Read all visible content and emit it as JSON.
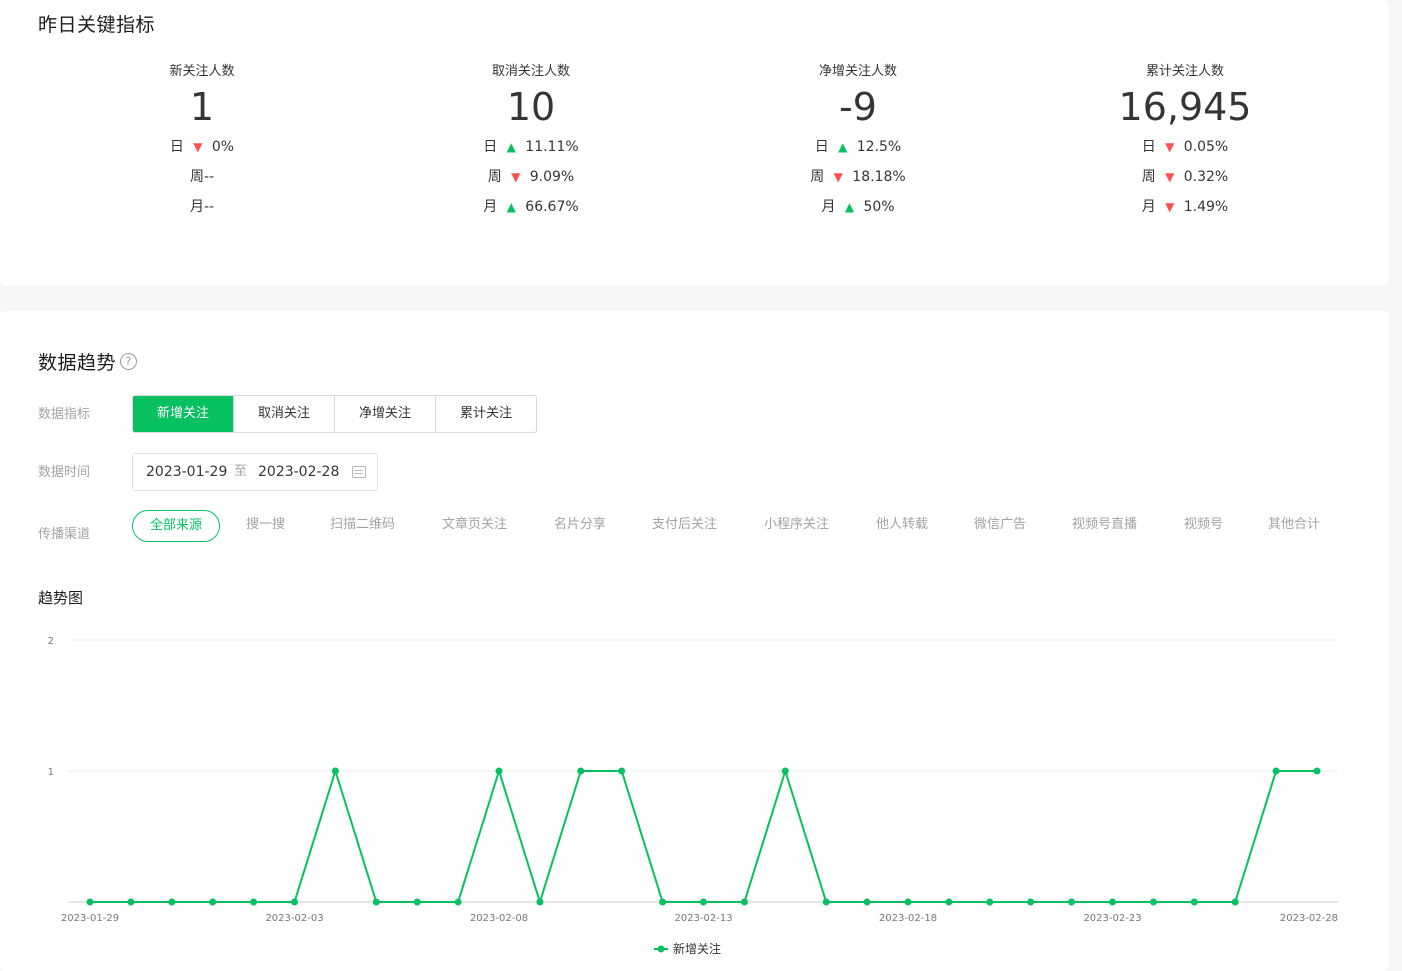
{
  "yesterday": {
    "title": "昨日关键指标",
    "metrics": [
      {
        "label": "新关注人数",
        "value": "1",
        "rows": [
          {
            "period": "日",
            "direction": "down",
            "change": "0%"
          },
          {
            "period": "周",
            "direction": "none",
            "change": "--"
          },
          {
            "period": "月",
            "direction": "none",
            "change": "--"
          }
        ]
      },
      {
        "label": "取消关注人数",
        "value": "10",
        "rows": [
          {
            "period": "日",
            "direction": "up",
            "change": "11.11%"
          },
          {
            "period": "周",
            "direction": "down",
            "change": "9.09%"
          },
          {
            "period": "月",
            "direction": "up",
            "change": "66.67%"
          }
        ]
      },
      {
        "label": "净增关注人数",
        "value": "-9",
        "rows": [
          {
            "period": "日",
            "direction": "up",
            "change": "12.5%"
          },
          {
            "period": "周",
            "direction": "down",
            "change": "18.18%"
          },
          {
            "period": "月",
            "direction": "up",
            "change": "50%"
          }
        ]
      },
      {
        "label": "累计关注人数",
        "value": "16,945",
        "rows": [
          {
            "period": "日",
            "direction": "down",
            "change": "0.05%"
          },
          {
            "period": "周",
            "direction": "down",
            "change": "0.32%"
          },
          {
            "period": "月",
            "direction": "down",
            "change": "1.49%"
          }
        ]
      }
    ]
  },
  "trend": {
    "title": "数据趋势",
    "help_glyph": "?",
    "metric_label": "数据指标",
    "metric_tabs": [
      {
        "label": "新增关注",
        "active": true
      },
      {
        "label": "取消关注",
        "active": false
      },
      {
        "label": "净增关注",
        "active": false
      },
      {
        "label": "累计关注",
        "active": false
      }
    ],
    "time_label": "数据时间",
    "date_start": "2023-01-29",
    "date_sep": "至",
    "date_end": "2023-02-28",
    "channel_label": "传播渠道",
    "channels": [
      {
        "label": "全部来源",
        "active": true
      },
      {
        "label": "搜一搜",
        "active": false
      },
      {
        "label": "扫描二维码",
        "active": false
      },
      {
        "label": "文章页关注",
        "active": false
      },
      {
        "label": "名片分享",
        "active": false
      },
      {
        "label": "支付后关注",
        "active": false
      },
      {
        "label": "小程序关注",
        "active": false
      },
      {
        "label": "他人转载",
        "active": false
      },
      {
        "label": "微信广告",
        "active": false
      },
      {
        "label": "视频号直播",
        "active": false
      },
      {
        "label": "视频号",
        "active": false
      },
      {
        "label": "其他合计",
        "active": false
      }
    ],
    "chart_title": "趋势图"
  },
  "colors": {
    "accent": "#07c160",
    "up": "#07c160",
    "down": "#fa5151"
  },
  "chart_data": {
    "type": "line",
    "title": "",
    "xlabel": "",
    "ylabel": "",
    "ylim": [
      0,
      2
    ],
    "y_ticks": [
      "1",
      "2"
    ],
    "x_tick_labels": [
      "2023-01-29",
      "2023-02-03",
      "2023-02-08",
      "2023-02-13",
      "2023-02-18",
      "2023-02-23",
      "2023-02-28"
    ],
    "x": [
      "2023-01-29",
      "2023-01-30",
      "2023-01-31",
      "2023-02-01",
      "2023-02-02",
      "2023-02-03",
      "2023-02-04",
      "2023-02-05",
      "2023-02-06",
      "2023-02-07",
      "2023-02-08",
      "2023-02-09",
      "2023-02-10",
      "2023-02-11",
      "2023-02-12",
      "2023-02-13",
      "2023-02-14",
      "2023-02-15",
      "2023-02-16",
      "2023-02-17",
      "2023-02-18",
      "2023-02-19",
      "2023-02-20",
      "2023-02-21",
      "2023-02-22",
      "2023-02-23",
      "2023-02-24",
      "2023-02-25",
      "2023-02-26",
      "2023-02-27",
      "2023-02-28"
    ],
    "series": [
      {
        "name": "新增关注",
        "color": "#07c160",
        "values": [
          0,
          0,
          0,
          0,
          0,
          0,
          1,
          0,
          0,
          0,
          1,
          0,
          1,
          1,
          0,
          0,
          0,
          1,
          0,
          0,
          0,
          0,
          0,
          0,
          0,
          0,
          0,
          0,
          0,
          1,
          1
        ]
      }
    ],
    "grid": true,
    "legend": "bottom-center"
  }
}
